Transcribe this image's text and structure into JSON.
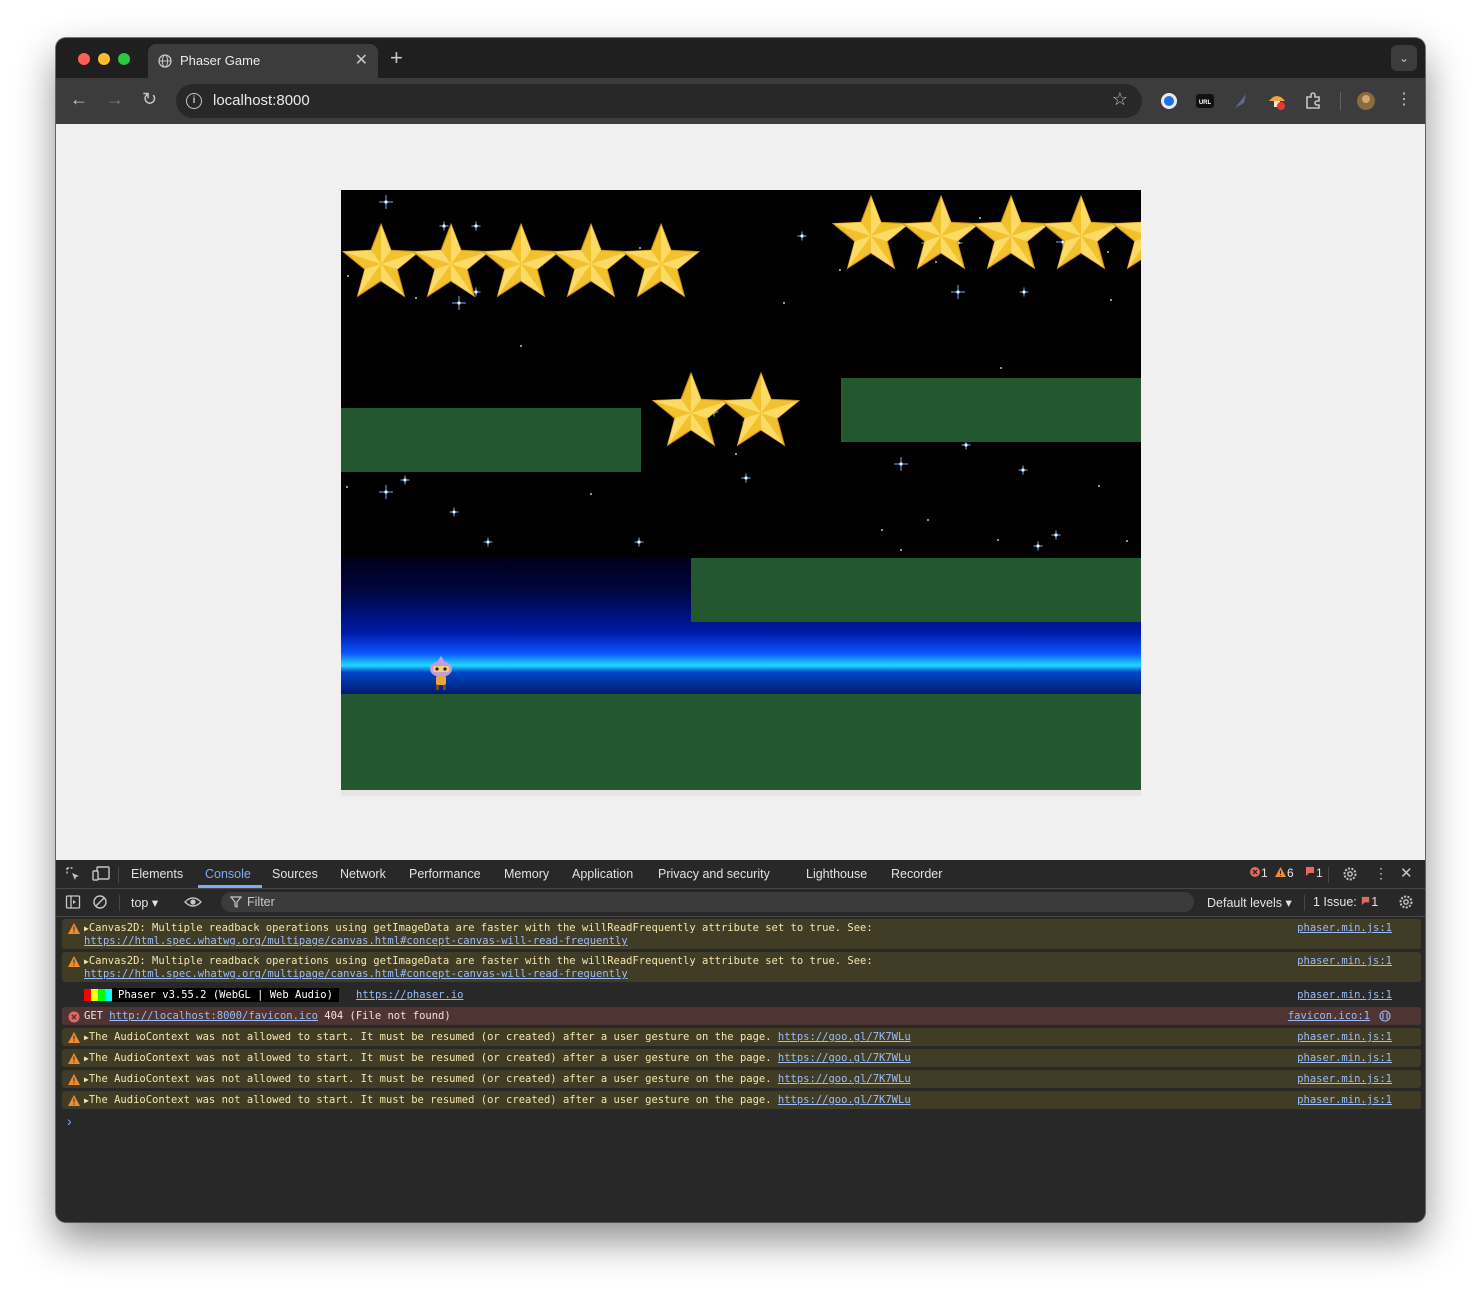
{
  "browser": {
    "tab_title": "Phaser Game",
    "tab_close": "✕",
    "new_tab": "+",
    "tabs_menu": "⌄",
    "url": "localhost:8000",
    "ext_url_label": "URL"
  },
  "devtools": {
    "tabs": [
      "Elements",
      "Console",
      "Sources",
      "Network",
      "Performance",
      "Memory",
      "Application",
      "Privacy and security",
      "Lighthouse",
      "Recorder"
    ],
    "active_tab": "Console",
    "counts": {
      "errors": "1",
      "warnings": "6",
      "issues": "1"
    },
    "context": "top",
    "filter_placeholder": "Filter",
    "levels": "Default levels",
    "issues_label": "1 Issue:",
    "issues_count": "1"
  },
  "console": {
    "canvas_msg": "Canvas2D: Multiple readback operations using getImageData are faster with the willReadFrequently attribute set to true. See:",
    "canvas_link": "https://html.spec.whatwg.org/multipage/canvas.html#concept-canvas-will-read-frequently",
    "phaser_banner": "Phaser v3.55.2 (WebGL | Web Audio)",
    "phaser_link": "https://phaser.io",
    "get_prefix": "GET",
    "favicon_url": "http://localhost:8000/favicon.ico",
    "favicon_status": "404 (File not found)",
    "favicon_src": "favicon.ico:1",
    "audio_msg": "The AudioContext was not allowed to start. It must be resumed (or created) after a user gesture on the page.",
    "audio_link": "https://goo.gl/7K7WLu",
    "src": "phaser.min.js:1",
    "prompt": "›"
  },
  "game": {
    "star_color": "#f2c12e",
    "platform_color": "#225730",
    "sky_color": "#000000"
  }
}
